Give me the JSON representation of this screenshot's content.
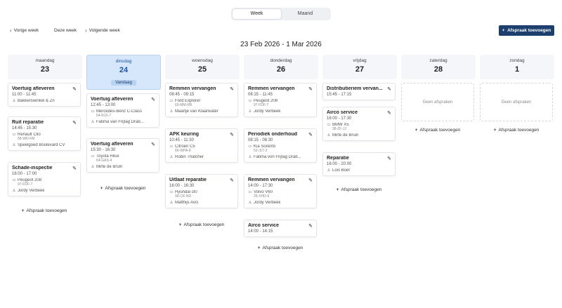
{
  "view_toggle": {
    "week": "Week",
    "month": "Maand"
  },
  "nav": {
    "prev": "Vorige week",
    "current": "Deze week",
    "next": "Volgende week"
  },
  "add_appointment": "Afspraak toevoegen",
  "date_range": "23 Feb 2026 - 1 Mar 2026",
  "empty_label": "Geen afspraken",
  "add_link": "Afspraak toevoegen",
  "days": [
    {
      "name": "maandag",
      "date": "23"
    },
    {
      "name": "dinsdag",
      "date": "24",
      "today_label": "Vandaag"
    },
    {
      "name": "woensdag",
      "date": "25"
    },
    {
      "name": "donderdag",
      "date": "26"
    },
    {
      "name": "vrijdag",
      "date": "27"
    },
    {
      "name": "zaterdag",
      "date": "28"
    },
    {
      "name": "zondag",
      "date": "1"
    }
  ],
  "appointments": {
    "mon": [
      {
        "title": "Voertuig afleveren",
        "time": "11:00 - 11:45",
        "customer": "Bakkerswinkel & Zn"
      },
      {
        "title": "Ruit reparatie",
        "time": "14:45 - 15:30",
        "vehicle": "Renault Clio",
        "plate": "58-WD-FM",
        "customer": "Speelgoed Boulevard CV"
      },
      {
        "title": "Schade-inspectie",
        "time": "16:00 - 17:00",
        "vehicle": "Peugeot 208",
        "plate": "97-FDF-7",
        "customer": "Jordy Verbeek"
      }
    ],
    "tue": [
      {
        "title": "Voertuig afleveren",
        "time": "12:45 - 13:00",
        "vehicle": "Mercedes-Benz C-Class",
        "plate": "54-RJX-7",
        "customer": "Fatima van Frijtag Drab..."
      },
      {
        "title": "Voertuig afleveren",
        "time": "15:30 - 16:30",
        "vehicle": "Toyota Hilux",
        "plate": "64-GAS-4",
        "customer": "Mirte de Bruin"
      }
    ],
    "wed": [
      {
        "title": "Remmen vervangen",
        "time": "08:45 - 09:15",
        "vehicle": "Ford Explorer",
        "plate": "69-MM-RB",
        "customer": "Maartje van Klaarwater"
      },
      {
        "title": "APK keuring",
        "time": "10:45 - 11:30",
        "vehicle": "Citroën C5",
        "plate": "66-WPA-8",
        "customer": "Robin Thatcher"
      },
      {
        "title": "Uitlaat reparatie",
        "time": "16:00 - 16:30",
        "vehicle": "Hyundai i30",
        "plate": "96-CK-ND",
        "customer": "Matthijs Avci"
      }
    ],
    "thu": [
      {
        "title": "Remmen vervangen",
        "time": "08:15 - 11:45",
        "vehicle": "Peugeot 208",
        "plate": "97-FDF-7",
        "customer": "Jordy Verbeek"
      },
      {
        "title": "Periodiek onderhoud",
        "time": "08:15 - 08:30",
        "vehicle": "Kia Sorento",
        "plate": "52-JLT-2",
        "customer": "Fatima von Frijtag Drab..."
      },
      {
        "title": "Remmen vervangen",
        "time": "14:00 - 17:30",
        "vehicle": "Volvo V60",
        "plate": "25-XHD-6",
        "customer": "Jordy Verbeek"
      },
      {
        "title": "Airco service",
        "time": "14:00 - 14:15"
      }
    ],
    "fri": [
      {
        "title": "Distributieriem vervan...",
        "time": "15:45 - 17:15"
      },
      {
        "title": "Airco service",
        "time": "16:00 - 17:30",
        "vehicle": "BMW X5",
        "plate": "38-ZF-JJ",
        "customer": "Mirte de Bruin"
      },
      {
        "title": "Reparatie",
        "time": "16:00 - 20:00",
        "customer": "Lois Boer"
      }
    ]
  }
}
